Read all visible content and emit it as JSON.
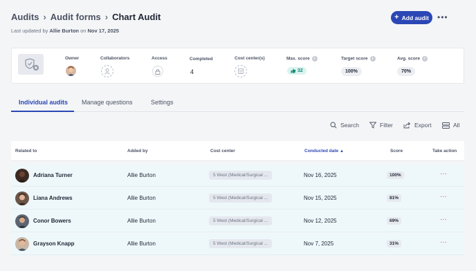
{
  "breadcrumb": {
    "items": [
      "Audits",
      "Audit forms"
    ],
    "current": "Chart Audit"
  },
  "updated": {
    "prefix": "Last updated by",
    "user": "Allie Burton",
    "on": "on",
    "date": "Nov 17, 2025"
  },
  "header": {
    "add_label": "Add audit"
  },
  "summary": {
    "owner_label": "Owner",
    "collaborators_label": "Collaborators",
    "access_label": "Access",
    "completed_label": "Completed",
    "completed_value": "4",
    "cost_center_label": "Cost center(s)",
    "max_score_label": "Max. score",
    "max_score_value": "32",
    "target_score_label": "Target score",
    "target_score_value": "100%",
    "avg_score_label": "Avg. score",
    "avg_score_value": "70%"
  },
  "tabs": [
    {
      "label": "Individual audits",
      "active": true
    },
    {
      "label": "Manage questions",
      "active": false
    },
    {
      "label": "Settings",
      "active": false
    }
  ],
  "toolbar": {
    "search": "Search",
    "filter": "Filter",
    "export": "Export",
    "view": "All"
  },
  "table": {
    "headers": [
      "Related to",
      "Added by",
      "Cost center",
      "Conducted date",
      "Score",
      "Take action"
    ],
    "rows": [
      {
        "name": "Adriana Turner",
        "added_by": "Allie Burton",
        "cost_center": "5 West (Medical/Surgical ...",
        "date": "Nov 16, 2025",
        "score": "100%"
      },
      {
        "name": "Liana Andrews",
        "added_by": "Allie Burton",
        "cost_center": "5 West (Medical/Surgical ...",
        "date": "Nov 15, 2025",
        "score": "81%"
      },
      {
        "name": "Conor Bowers",
        "added_by": "Allie Burton",
        "cost_center": "5 West (Medical/Surgical ...",
        "date": "Nov 12, 2025",
        "score": "69%"
      },
      {
        "name": "Grayson Knapp",
        "added_by": "Allie Burton",
        "cost_center": "5 West (Medical/Surgical ...",
        "date": "Nov 7, 2025",
        "score": "31%"
      }
    ]
  },
  "colors": {
    "accent": "#2b47b5",
    "row_bg": "#eef8fb",
    "max_score_bg": "#daf3ef",
    "action_dots": "#c2533f"
  }
}
